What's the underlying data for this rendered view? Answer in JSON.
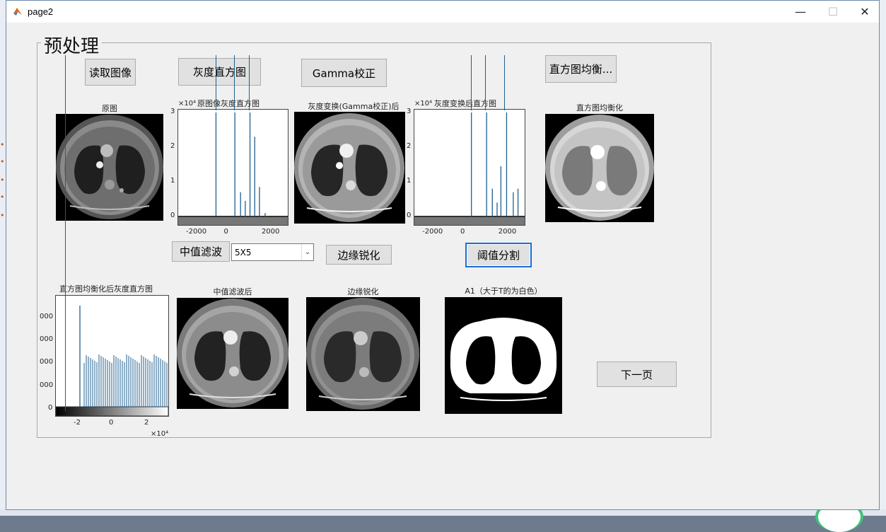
{
  "window": {
    "title": "page2"
  },
  "panel": {
    "title": "预处理"
  },
  "buttons": {
    "read": "读取图像",
    "hist": "灰度直方图",
    "gamma": "Gamma校正",
    "histeq": "直方图均衡...",
    "median": "中值滤波",
    "sharpen": "边缘锐化",
    "threshold": "阈值分割",
    "next": "下一页"
  },
  "filter_select": {
    "value": "5X5"
  },
  "captions": {
    "original": "原图",
    "orig_hist": "原图像灰度直方图",
    "gamma_img": "灰度变换(Gamma校正)后",
    "gamma_hist": "灰度变换后直方图",
    "histeq_img": "直方图均衡化",
    "histeq_hist": "直方图均衡化后灰度直方图",
    "median_img": "中值滤波后",
    "sharpen_img": "边缘锐化",
    "threshold_img": "A1（大于T的为白色）"
  },
  "axes_labels": {
    "exp1": "×10⁴",
    "exp2": "×10⁴",
    "exp3": "×10⁴"
  },
  "chart_data": [
    {
      "type": "bar",
      "title": "原图像灰度直方图",
      "x": [
        -900,
        100,
        900,
        1150,
        400,
        650,
        1400,
        1700
      ],
      "values": [
        3.0,
        3.0,
        3.0,
        2.3,
        0.7,
        0.45,
        0.85,
        0.1
      ],
      "xlim": [
        -2900,
        2900
      ],
      "ylim": [
        0,
        3
      ],
      "xticks": [
        -2000,
        0,
        2000
      ],
      "yticks": [
        0,
        1,
        2,
        3
      ],
      "y_multiplier": "×10⁴"
    },
    {
      "type": "bar",
      "title": "灰度变换后直方图",
      "x": [
        100,
        900,
        1950,
        1200,
        1450,
        1650,
        2300,
        2550
      ],
      "values": [
        3.0,
        3.0,
        3.0,
        0.8,
        0.4,
        1.45,
        0.7,
        0.8
      ],
      "xlim": [
        -2900,
        2900
      ],
      "ylim": [
        0,
        3
      ],
      "xticks": [
        -2000,
        0,
        2000
      ],
      "yticks": [
        0,
        1,
        2,
        3
      ],
      "y_multiplier": "×10⁴"
    },
    {
      "type": "bar",
      "title": "直方图均衡化后灰度直方图",
      "yticks_visible": [
        "0",
        "000",
        "000",
        "000",
        "000"
      ],
      "xticks": [
        "-2",
        "0",
        "2"
      ],
      "x_multiplier": "×10⁴"
    }
  ]
}
